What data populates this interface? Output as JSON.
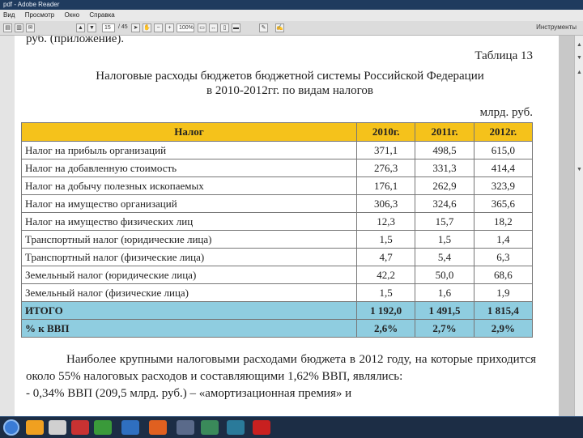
{
  "window": {
    "title": "pdf - Adobe Reader"
  },
  "menu": [
    "Вид",
    "Просмотр",
    "Окно",
    "Справка"
  ],
  "toolbar": {
    "page_current": "15",
    "page_total": "/ 45",
    "zoom": "100%",
    "tools_label": "Инструменты"
  },
  "document": {
    "prev_text": "руб. (приложение).",
    "table_label": "Таблица 13",
    "heading_line1": "Налоговые расходы бюджетов бюджетной системы Российской Федерации",
    "heading_line2": "в 2010-2012гг. по видам налогов",
    "units": "млрд. руб.",
    "table": {
      "headers": [
        "Налог",
        "2010г.",
        "2011г.",
        "2012г."
      ],
      "rows": [
        [
          "Налог на прибыль организаций",
          "371,1",
          "498,5",
          "615,0"
        ],
        [
          "Налог на добавленную стоимость",
          "276,3",
          "331,3",
          "414,4"
        ],
        [
          "Налог на добычу полезных ископаемых",
          "176,1",
          "262,9",
          "323,9"
        ],
        [
          "Налог на имущество организаций",
          "306,3",
          "324,6",
          "365,6"
        ],
        [
          "Налог на имущество физических лиц",
          "12,3",
          "15,7",
          "18,2"
        ],
        [
          "Транспортный налог (юридические лица)",
          "1,5",
          "1,5",
          "1,4"
        ],
        [
          "Транспортный налог (физические лица)",
          "4,7",
          "5,4",
          "6,3"
        ],
        [
          "Земельный налог (юридические лица)",
          "42,2",
          "50,0",
          "68,6"
        ],
        [
          "Земельный налог (физические лица)",
          "1,5",
          "1,6",
          "1,9"
        ]
      ],
      "total_rows": [
        [
          "ИТОГО",
          "1 192,0",
          "1 491,5",
          "1 815,4"
        ],
        [
          "% к ВВП",
          "2,6%",
          "2,7%",
          "2,9%"
        ]
      ]
    },
    "paragraph": "Наиболее крупными налоговыми расходами бюджета в 2012 году, на которые приходится около 55% налоговых расходов и составляющими 1,62% ВВП, являлись:",
    "bullet": "- 0,34% ВВП (209,5 млрд. руб.) – «амортизационная премия» и"
  },
  "colors": {
    "header_row": "#f5c21b",
    "total_row": "#8fcde0",
    "taskbar": "#1c2d45"
  }
}
